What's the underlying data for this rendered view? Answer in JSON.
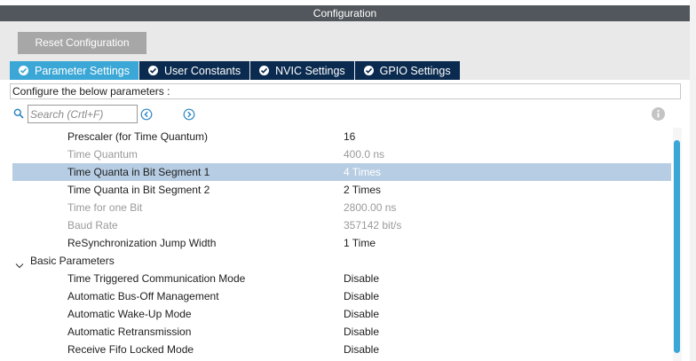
{
  "window": {
    "title": "Configuration"
  },
  "toolbar": {
    "reset_label": "Reset Configuration"
  },
  "tabs": [
    {
      "label": "Parameter Settings",
      "active": true
    },
    {
      "label": "User Constants",
      "active": false
    },
    {
      "label": "NVIC Settings",
      "active": false
    },
    {
      "label": "GPIO Settings",
      "active": false
    }
  ],
  "configure_text": "Configure the below parameters :",
  "search": {
    "placeholder": "Search (Crtl+F)",
    "value": ""
  },
  "params": [
    {
      "name": "Prescaler (for Time Quantum)",
      "value": "16",
      "editable": true,
      "selected": false
    },
    {
      "name": "Time Quantum",
      "value": "400.0 ns",
      "editable": false,
      "selected": false
    },
    {
      "name": "Time Quanta in Bit Segment 1",
      "value": "4 Times",
      "editable": true,
      "selected": true
    },
    {
      "name": "Time Quanta in Bit Segment 2",
      "value": "2 Times",
      "editable": true,
      "selected": false
    },
    {
      "name": "Time for one Bit",
      "value": "2800.00 ns",
      "editable": false,
      "selected": false
    },
    {
      "name": "Baud Rate",
      "value": "357142 bit/s",
      "editable": false,
      "selected": false
    },
    {
      "name": "ReSynchronization Jump Width",
      "value": "1 Time",
      "editable": true,
      "selected": false
    }
  ],
  "basic_category": {
    "label": "Basic Parameters",
    "params": [
      {
        "name": "Time Triggered Communication Mode",
        "value": "Disable"
      },
      {
        "name": "Automatic Bus-Off Management",
        "value": "Disable"
      },
      {
        "name": "Automatic Wake-Up Mode",
        "value": "Disable"
      },
      {
        "name": "Automatic Retransmission",
        "value": "Disable"
      },
      {
        "name": "Receive Fifo Locked Mode",
        "value": "Disable"
      }
    ]
  },
  "colors": {
    "title_bar": "#51575c",
    "tab_active": "#3ba7d6",
    "tab_inactive": "#0a2b4f",
    "selection": "#b7cde3",
    "scroll_thumb": "#3ba7d6"
  },
  "icons": {
    "tab_check": "check-circle-icon",
    "search": "magnifier-icon",
    "prev": "arrow-left-circle-icon",
    "next": "arrow-right-circle-icon",
    "info": "info-icon",
    "expand": "chevron-down-icon"
  }
}
